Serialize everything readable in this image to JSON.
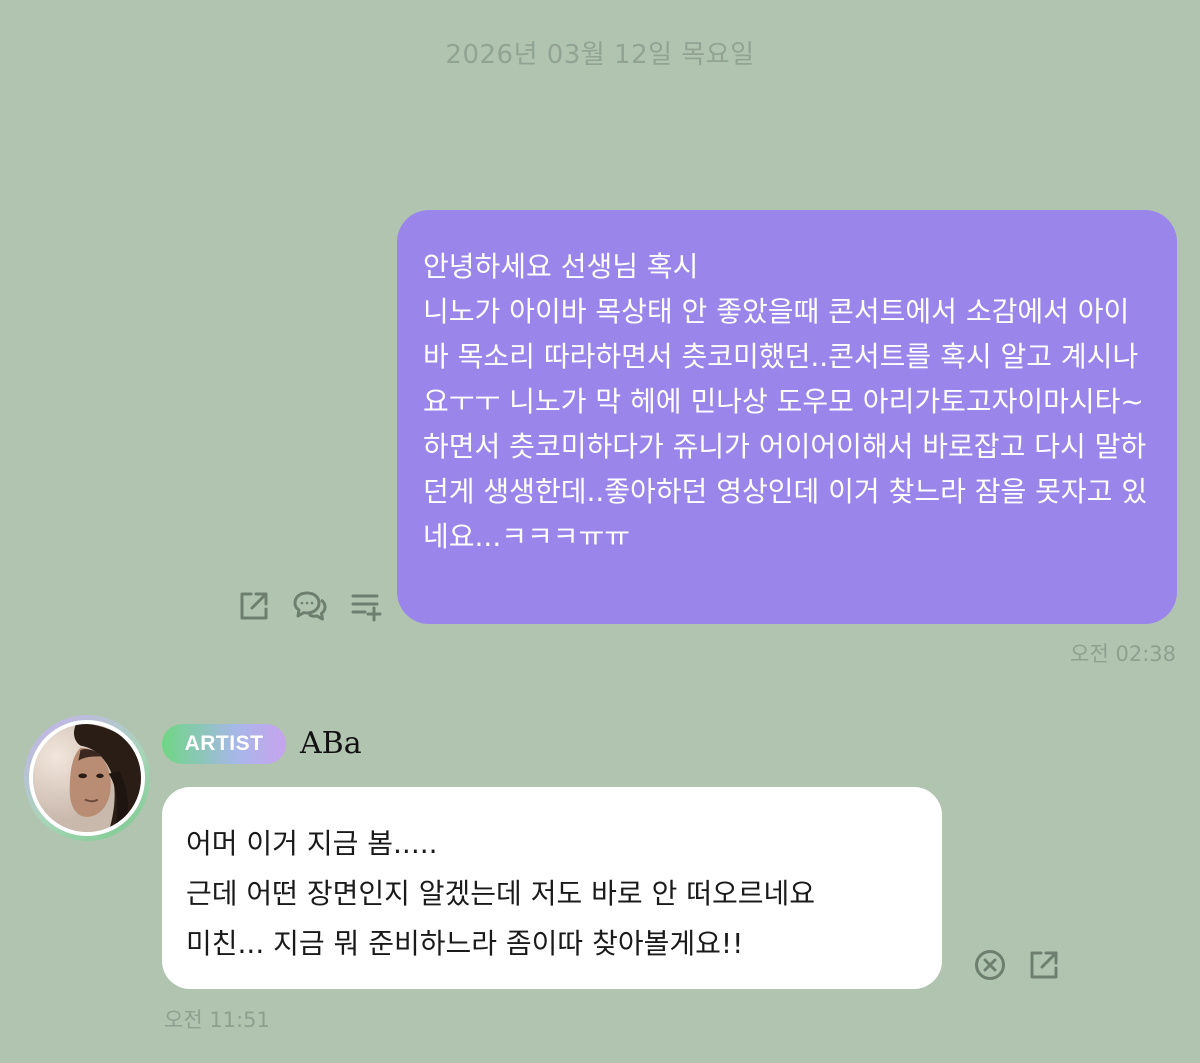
{
  "date_header": "2026년 03월 12일 목요일",
  "sent_message": {
    "lines": [
      "안녕하세요 선생님 혹시",
      "니노가 아이바 목상태 안 좋았을때 콘서트에서 소감에서 아이바 목소리 따라하면서 츳코미했던..콘서트를 혹시 알고 계시나요ㅜㅜ 니노가 막 헤에 민나상 도우모 아리가토고자이마시타~하면서 츳코미하다가 쥬니가 어이어이해서 바로잡고 다시 말하던게 생생한데..좋아하던 영상인데 이거 찾느라 잠을 못자고 있네요...ㅋㅋㅋㅠㅠ"
    ],
    "time": "오전 02:38",
    "bubble_color": "#9a86ea",
    "actions": [
      {
        "name": "share",
        "icon": "share-icon"
      },
      {
        "name": "reply",
        "icon": "chat-bubbles-icon"
      },
      {
        "name": "add-to-list",
        "icon": "list-add-icon"
      }
    ]
  },
  "received_message": {
    "badge": "ARTIST",
    "sender_name": "ABa",
    "lines": [
      "어머 이거 지금 봄.....",
      "근데 어떤 장면인지 알겠는데 저도 바로 안 떠오르네요",
      "미친... 지금 뭐 준비하느라 좀이따 찾아볼게요!!"
    ],
    "time": "오전 11:51",
    "actions": [
      {
        "name": "dismiss",
        "icon": "close-circle-icon"
      },
      {
        "name": "share",
        "icon": "share-icon"
      }
    ]
  },
  "colors": {
    "background": "#b0c4b0",
    "timestamp": "#8ea08e",
    "icon": "#6f7f6f",
    "badge_gradient_start": "#6fd684",
    "badge_gradient_end": "#c7a3ee"
  }
}
